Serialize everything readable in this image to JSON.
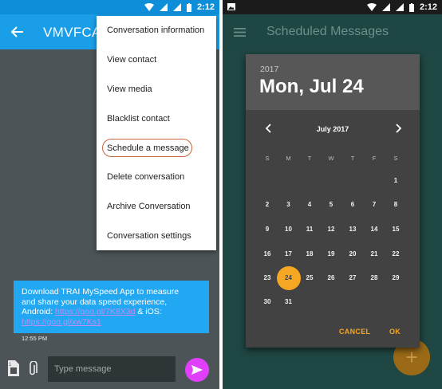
{
  "left": {
    "status_time": "2:12",
    "title": "VMVFCAR",
    "menu": [
      "Conversation information",
      "View contact",
      "View media",
      "Blacklist contact",
      "Schedule a message",
      "Delete conversation",
      "Archive Conversation",
      "Conversation settings"
    ],
    "message": {
      "line1": "Download TRAI MySpeed App to measure",
      "line2": "and share your data speed experience,",
      "line3": "Android:",
      "link1": "https://goo.gl/7K8X3d",
      "sep": " & iOS:",
      "link2": "https://goo.gl/xw7Ks1",
      "time": "12:55 PM"
    },
    "compose_placeholder": "Type message"
  },
  "right": {
    "status_time": "2:12",
    "title": "Scheduled Messages",
    "dialog": {
      "year": "2017",
      "date": "Mon, Jul 24",
      "month": "July 2017",
      "weekdays": [
        "S",
        "M",
        "T",
        "W",
        "T",
        "F",
        "S"
      ],
      "first_weekday_index": 6,
      "days_in_month": 31,
      "selected_day": 24,
      "cancel": "CANCEL",
      "ok": "OK"
    },
    "fab_icon": "+"
  },
  "colors": {
    "left_appbar": "#1a9ee8",
    "bubble": "#22a7f2",
    "send": "#e040fb",
    "accent": "#f5a623",
    "right_bg": "#1f4743"
  }
}
